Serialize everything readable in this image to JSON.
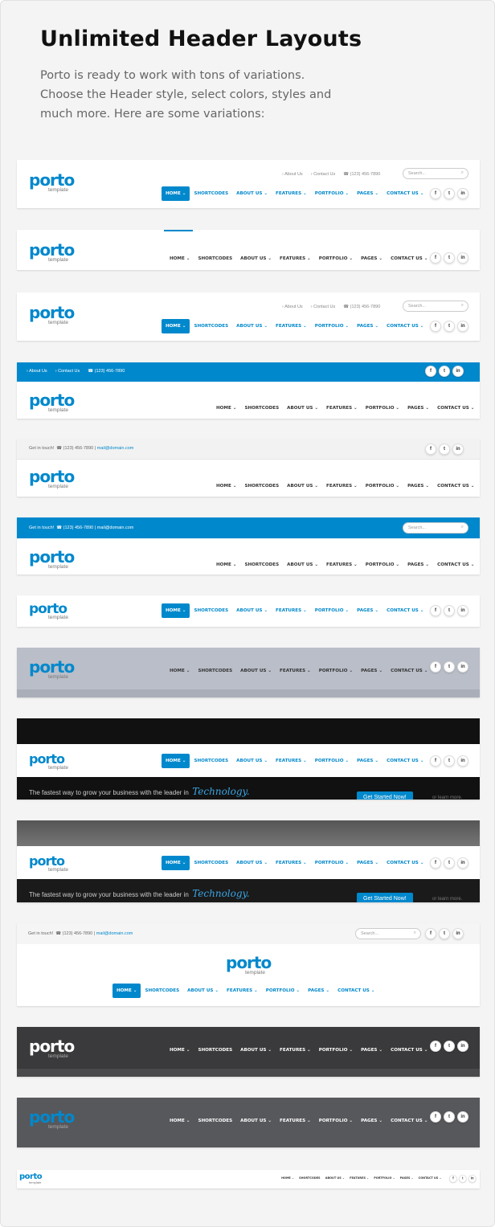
{
  "intro": {
    "title": "Unlimited Header Layouts",
    "text": "Porto  is ready to work with tons of variations. Choose the Header style, select colors, styles and much more. Here are some variations:"
  },
  "logo": {
    "word": "porto",
    "sub": "template"
  },
  "nav": {
    "home": "HOME",
    "shortcodes": "SHORTCODES",
    "about": "ABOUT US",
    "features": "FEATURES",
    "portfolio": "PORTFOLIO",
    "pages": "PAGES",
    "contact": "CONTACT US"
  },
  "top": {
    "about": "About Us",
    "contact": "Contact Us",
    "phone": "(123) 456-7890",
    "search_placeholder": "Search...",
    "get_in_touch": "Get in touch!",
    "mail": "mail@domain.com"
  },
  "social": {
    "facebook": "f",
    "twitter": "t",
    "linkedin": "in"
  },
  "hero": {
    "text": "The fastest way to grow your business with the leader in",
    "tech": "Technology.",
    "button": "Get Started Now!",
    "learn": "or learn more."
  },
  "colors": {
    "brand": "#0088cc",
    "dark": "#3a3a3a"
  }
}
